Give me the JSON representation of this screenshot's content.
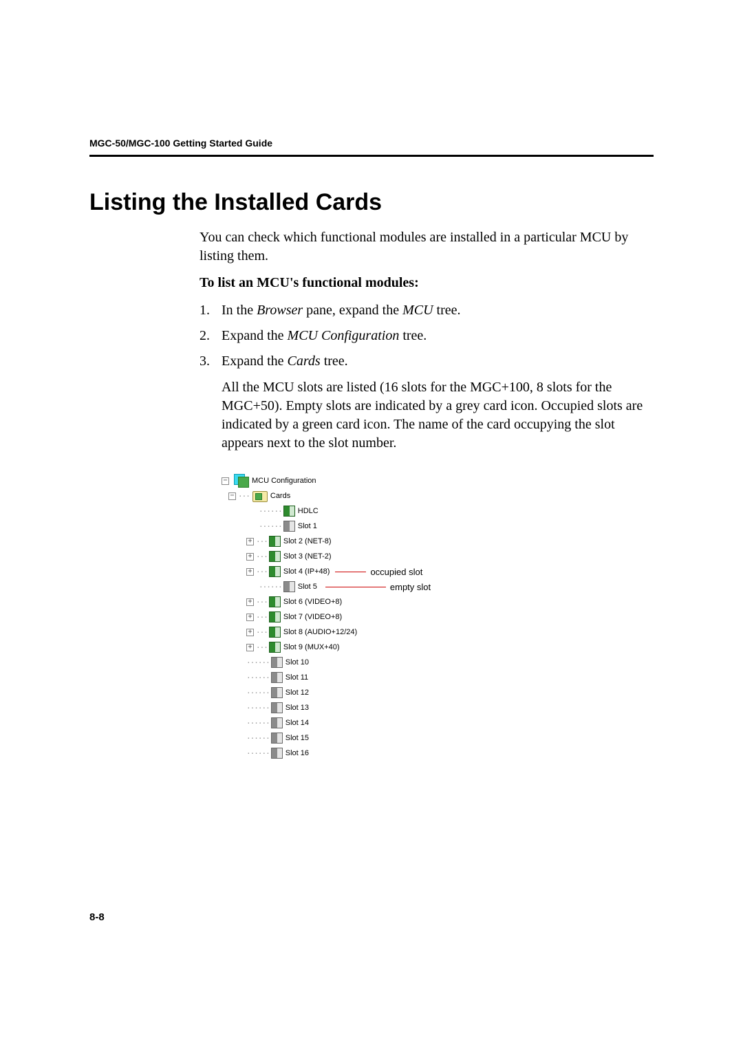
{
  "running_head": "MGC-50/MGC-100 Getting Started Guide",
  "h1": "Listing the Installed Cards",
  "intro": "You can check which functional modules are installed in a particular MCU by listing them.",
  "subhead": "To list an MCU's functional modules:",
  "steps": {
    "1_prefix": "In the ",
    "1_em1": "Browser",
    "1_mid": " pane, expand the ",
    "1_em2": "MCU",
    "1_suffix": " tree.",
    "2_prefix": "Expand the ",
    "2_em": "MCU Configuration",
    "2_suffix": " tree.",
    "3_prefix": "Expand the ",
    "3_em": "Cards",
    "3_suffix": " tree.",
    "3_para": "All the MCU slots are listed (16 slots for the MGC+100, 8 slots for the MGC+50). Empty slots are indicated by a grey card icon. Occupied slots are indicated by a green card icon. The name of the card occupying the slot appears next to the slot number."
  },
  "tree": {
    "config": "MCU Configuration",
    "cards": "Cards",
    "nodes": {
      "hdlc": "HDLC",
      "s1": "Slot  1",
      "s2": "Slot  2  (NET-8)",
      "s3": "Slot  3  (NET-2)",
      "s4": "Slot  4  (IP+48)",
      "s5": "Slot  5",
      "s6": "Slot  6  (VIDEO+8)",
      "s7": "Slot  7  (VIDEO+8)",
      "s8": "Slot  8  (AUDIO+12/24)",
      "s9": "Slot  9  (MUX+40)",
      "s10": "Slot  10",
      "s11": "Slot  11",
      "s12": "Slot  12",
      "s13": "Slot  13",
      "s14": "Slot  14",
      "s15": "Slot  15",
      "s16": "Slot  16"
    }
  },
  "callouts": {
    "occupied": "occupied slot",
    "empty": "empty slot"
  },
  "page_num": "8-8"
}
